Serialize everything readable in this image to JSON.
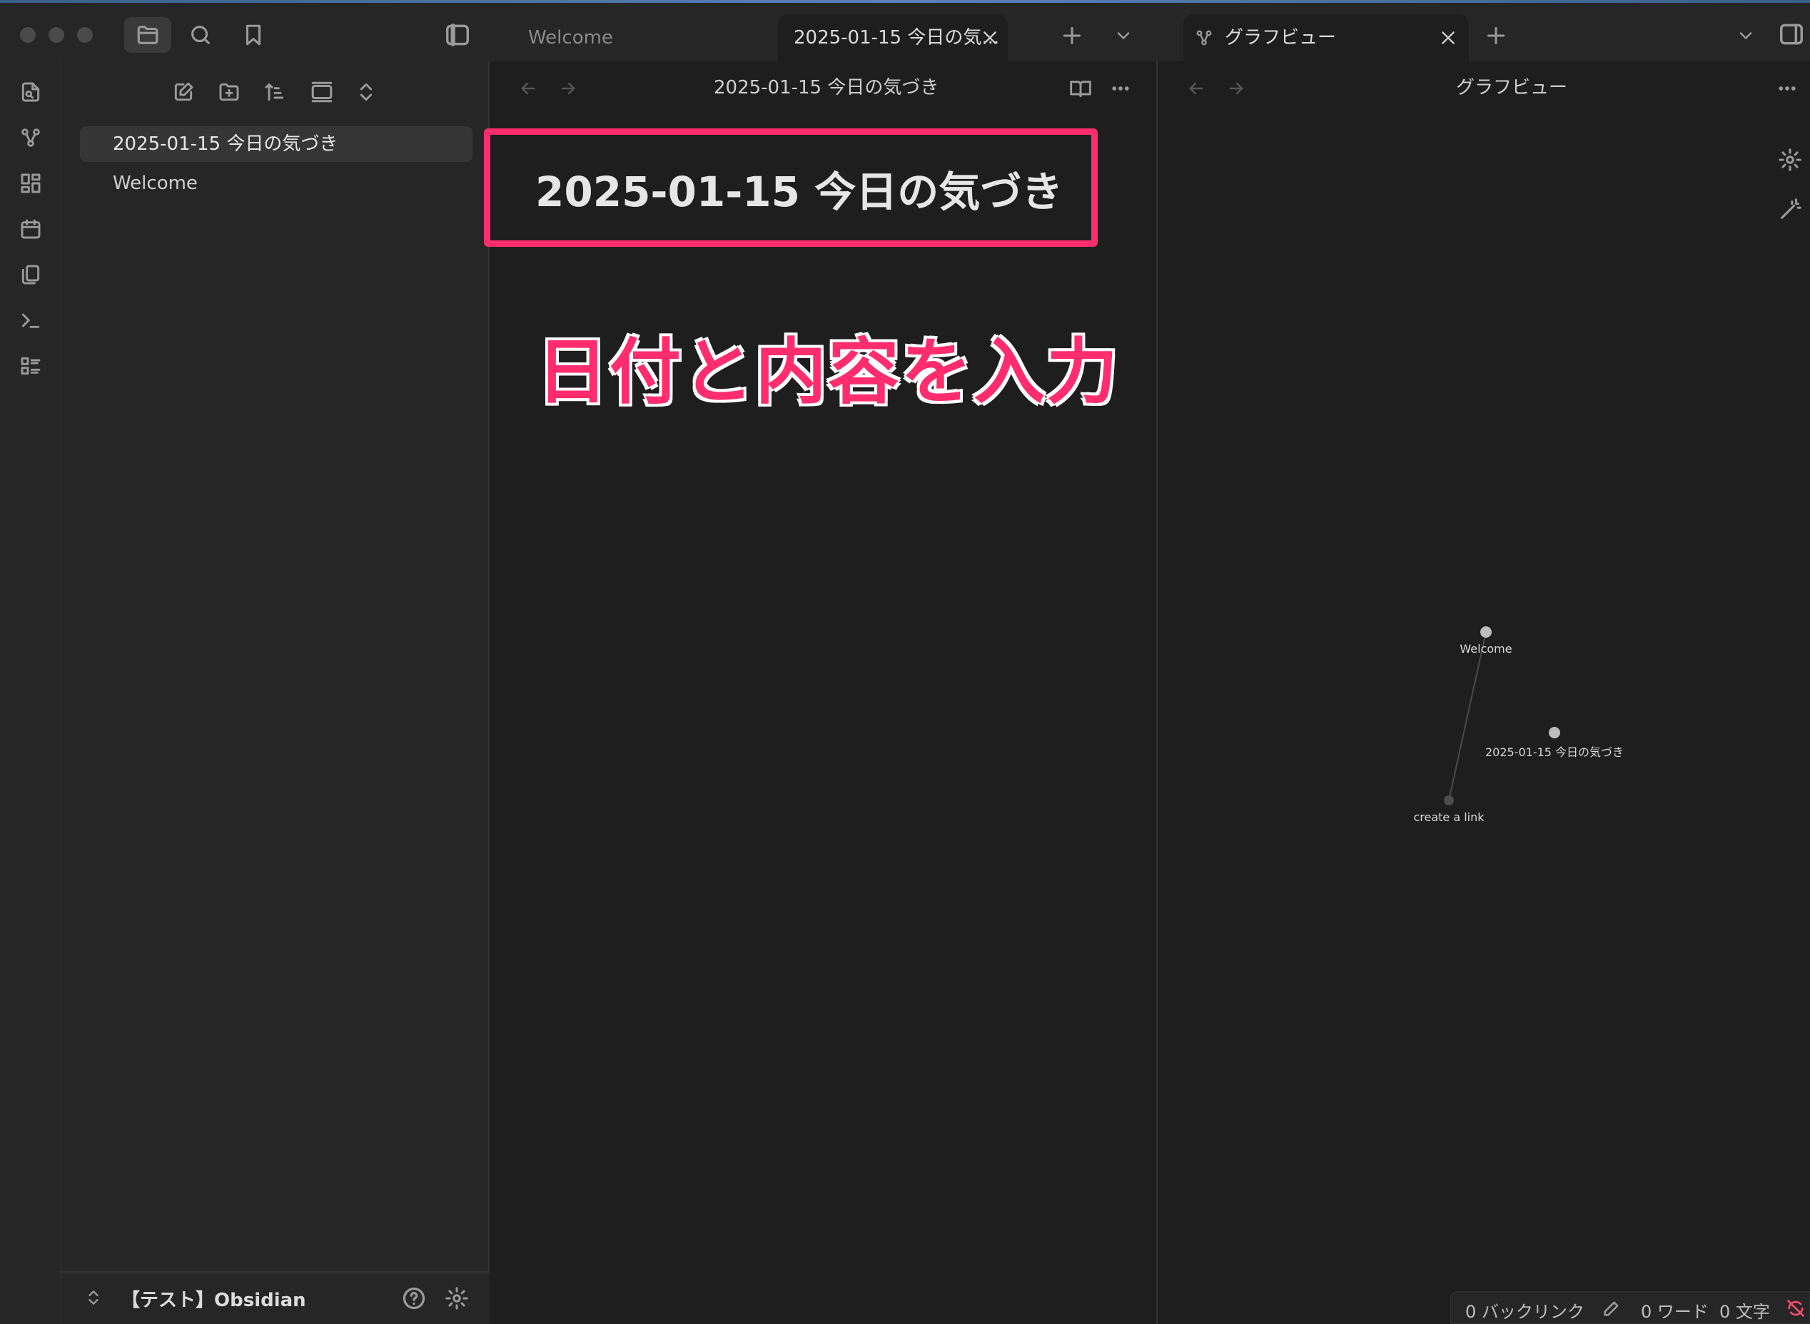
{
  "window": {
    "header_buttons": [
      {
        "name": "folder-icon"
      },
      {
        "name": "search-icon"
      },
      {
        "name": "bookmark-icon"
      }
    ]
  },
  "ribbon": {
    "items": [
      "open-quick-switcher-icon",
      "graph-view-icon",
      "canvas-icon",
      "daily-note-icon",
      "templates-icon",
      "command-palette-icon",
      "slides-icon"
    ]
  },
  "sidebar": {
    "actions": [
      "new-note-icon",
      "new-folder-icon",
      "sort-icon",
      "auto-reveal-icon",
      "collapse-all-icon"
    ],
    "files": [
      {
        "label": "2025-01-15 今日の気づき",
        "active": true
      },
      {
        "label": "Welcome",
        "active": false
      }
    ],
    "vault_name": "【テスト】Obsidian"
  },
  "editor": {
    "tabs": [
      {
        "label": "Welcome",
        "active": false
      },
      {
        "label": "2025-01-15 今日の気...",
        "active": true
      }
    ],
    "view_title": "2025-01-15 今日の気づき",
    "note_title": "2025-01-15 今日の気づき",
    "annotation": "日付と内容を入力"
  },
  "graph": {
    "tab_label": "グラフビュー",
    "view_title": "グラフビュー",
    "nodes": [
      {
        "label": "Welcome"
      },
      {
        "label": "2025-01-15 今日の気づき"
      },
      {
        "label": "create a link"
      }
    ]
  },
  "status": {
    "backlinks": "0 バックリンク",
    "words": "0 ワード",
    "chars": "0 文字"
  },
  "colors": {
    "accent": "#ff2d6d",
    "background": "#1e1e1e",
    "sidebar": "#262626"
  }
}
